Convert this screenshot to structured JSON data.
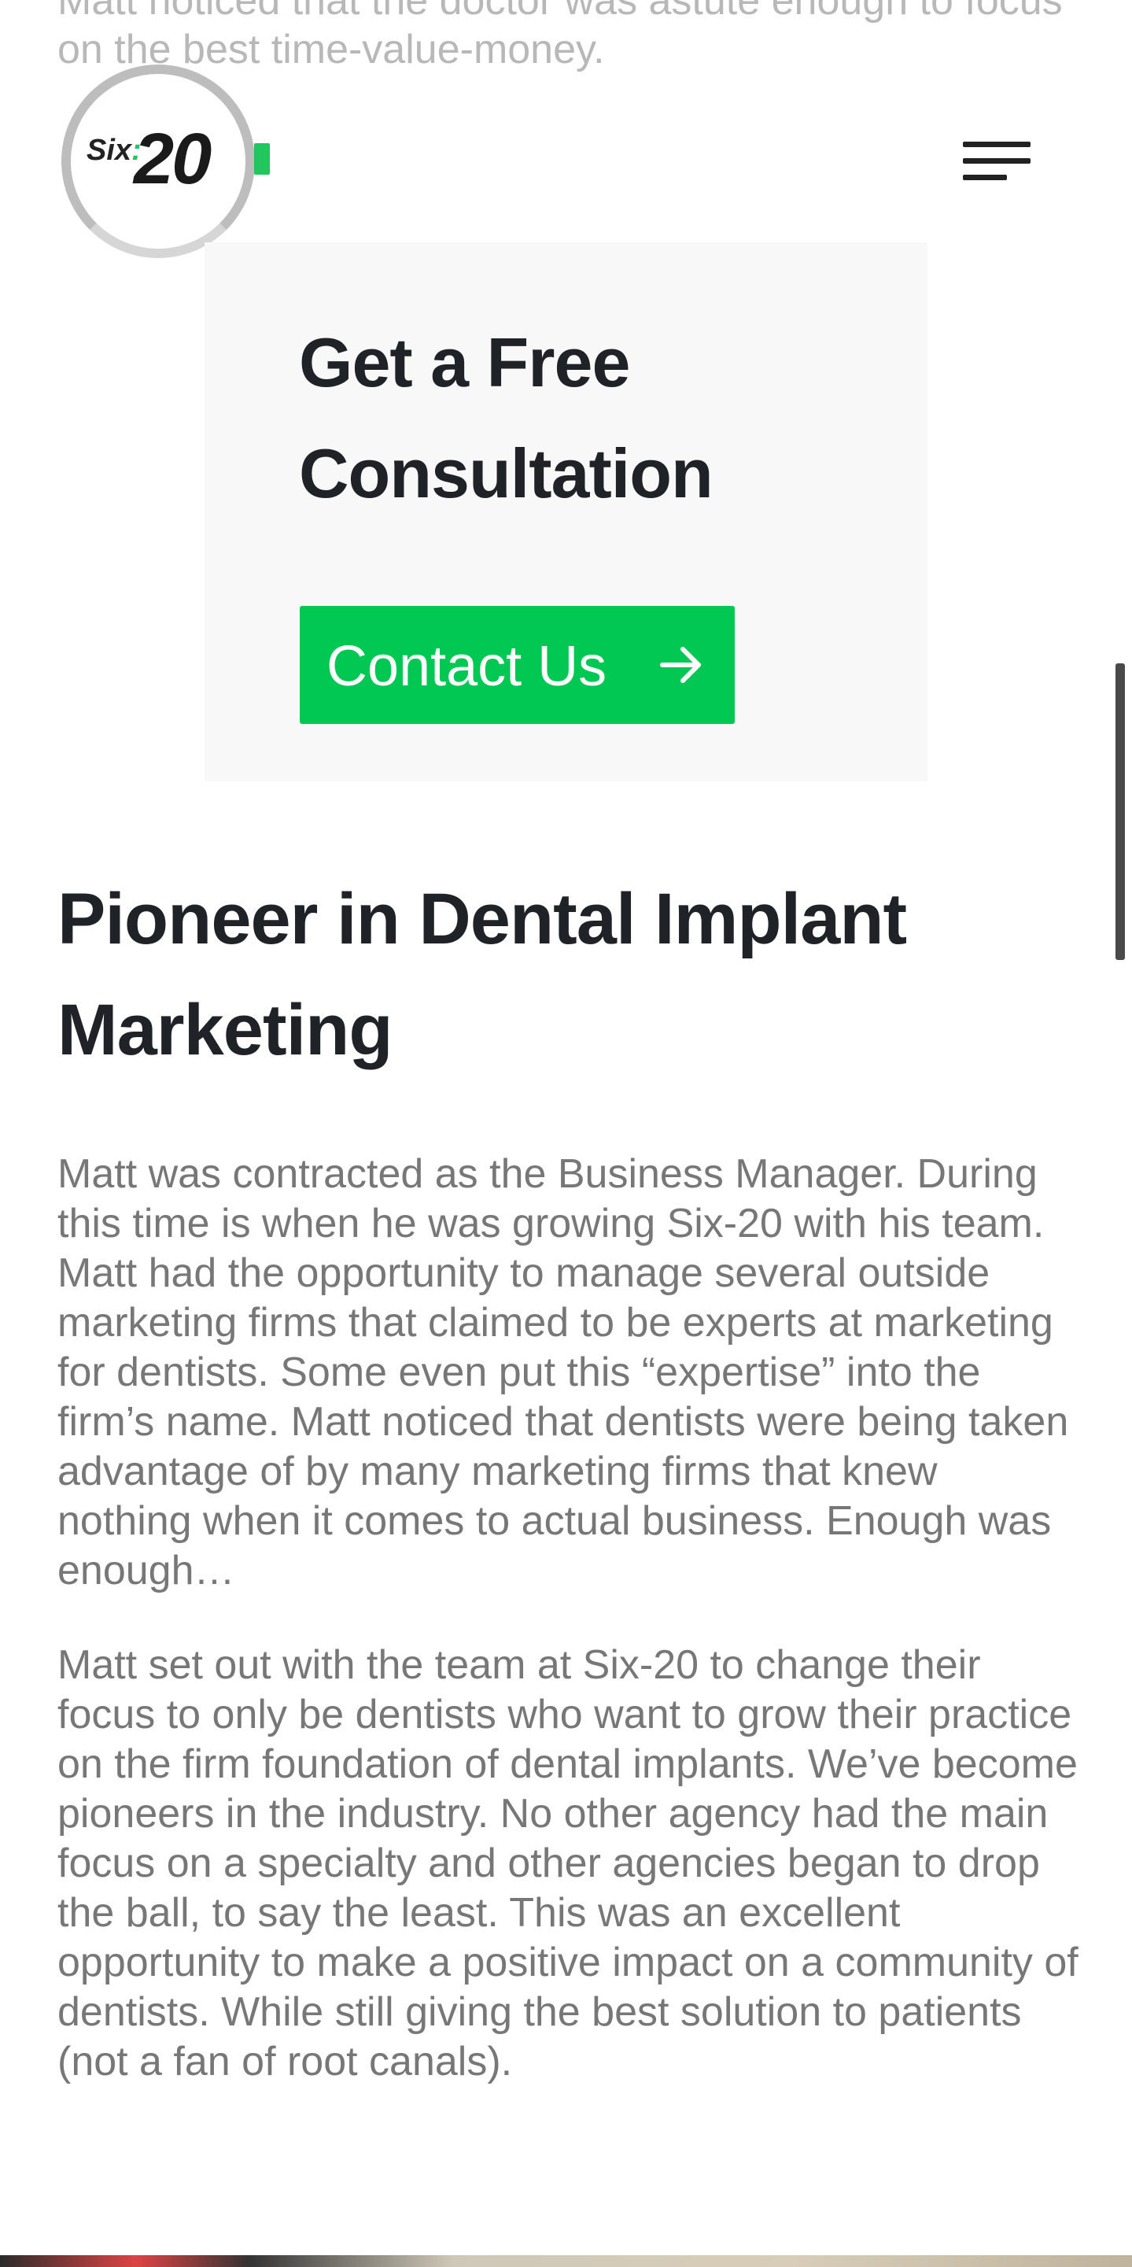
{
  "top_cut_text": "Matt noticed that the doctor was astute enough to focus on the best time-value-money.",
  "logo": {
    "six": "Six",
    "colon": ":",
    "twenty": "20"
  },
  "cta": {
    "title": "Get a Free Consultation",
    "button_label": "Contact Us"
  },
  "section": {
    "title": "Pioneer in Dental Implant Marketing",
    "paragraphs": [
      "Matt was contracted as the Business Manager. During this time is when he was growing Six-20 with his team. Matt had the opportunity to manage several outside marketing firms that claimed to be experts at marketing for dentists. Some even put this “expertise” into the firm’s name. Matt noticed that dentists were being taken advantage of by many marketing firms that knew nothing when it comes to actual business. Enough was enough…",
      "Matt set out with the team at Six-20 to change their focus to only be dentists who want to grow their practice on the firm foundation of dental implants. We’ve become pioneers in the industry. No other agency had the main focus on a specialty and other agencies began to drop the ball, to say the least. This was an excellent opportunity to make a positive impact on a community of dentists. While still giving the best solution to patients (not a fan of root canals)."
    ]
  },
  "colors": {
    "accent": "#00c853",
    "heading": "#1f2328",
    "body": "#777777",
    "card_bg": "#f8f8f8"
  },
  "icons": {
    "menu": "hamburger-menu-icon",
    "arrow": "arrow-right-icon"
  }
}
